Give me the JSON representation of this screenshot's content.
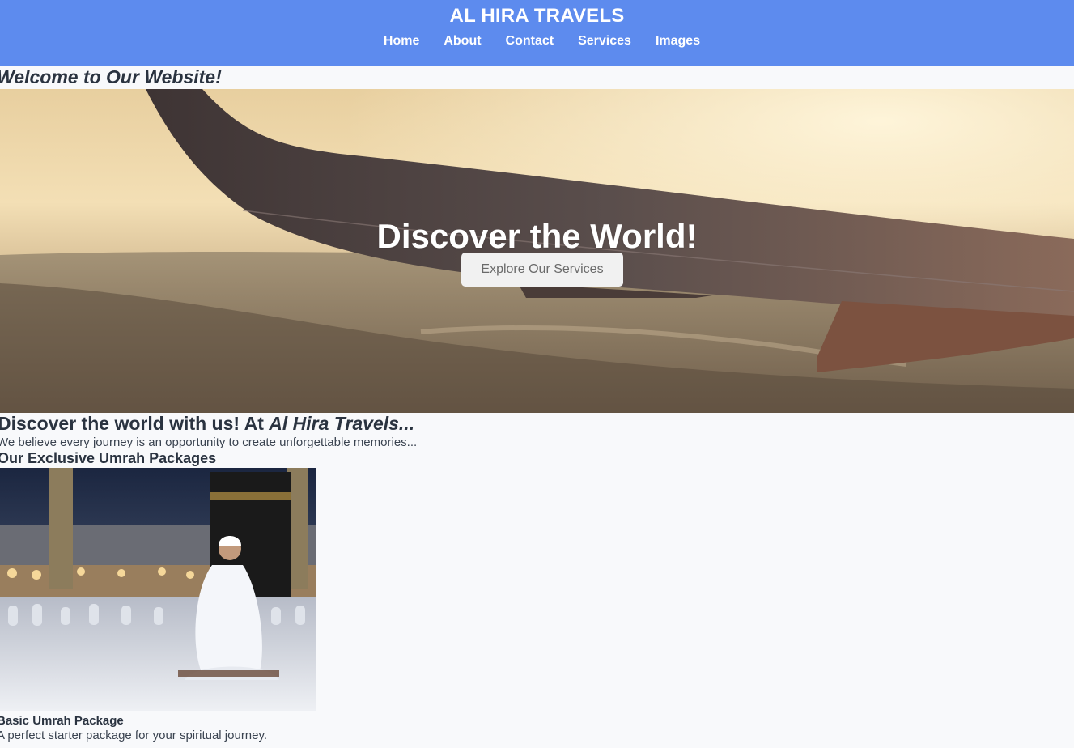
{
  "header": {
    "title": "AL HIRA TRAVELS",
    "nav": [
      "Home",
      "About",
      "Contact",
      "Services",
      "Images"
    ]
  },
  "welcome": "Welcome to Our Website!",
  "hero": {
    "title": "Discover the World!",
    "button_label": "Explore Our Services"
  },
  "intro": {
    "heading_prefix": "Discover the world with us! At ",
    "heading_brand": "Al Hira Travels...",
    "text": "We believe every journey is an opportunity to create unforgettable memories..."
  },
  "packages": {
    "heading": "Our Exclusive Umrah Packages",
    "items": [
      {
        "title": "Basic Umrah Package",
        "description": "A perfect starter package for your spiritual journey."
      }
    ]
  },
  "colors": {
    "header_bg": "#5d8bee",
    "page_bg": "#f8f9fb",
    "text": "#2a3340"
  }
}
